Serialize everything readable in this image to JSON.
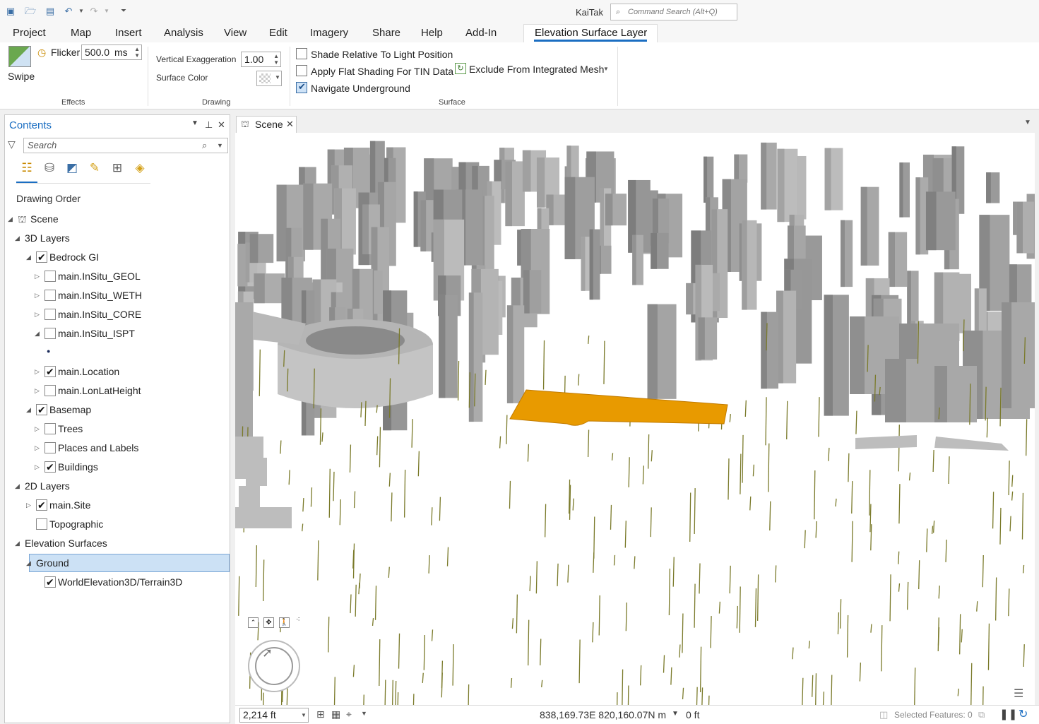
{
  "app": {
    "title": "KaiTak",
    "command_search_placeholder": "Command Search (Alt+Q)"
  },
  "ribbon_tabs": [
    "Project",
    "Map",
    "Insert",
    "Analysis",
    "View",
    "Edit",
    "Imagery",
    "Share",
    "Help",
    "Add-In",
    "Elevation Surface Layer"
  ],
  "ribbon": {
    "effects": {
      "swipe_label": "Swipe",
      "flicker_label": "Flicker",
      "flicker_value": "500.0",
      "flicker_unit": "ms",
      "group_label": "Effects"
    },
    "drawing": {
      "vertical_exaggeration_label": "Vertical Exaggeration",
      "vertical_exaggeration_value": "1.00",
      "surface_color_label": "Surface Color",
      "group_label": "Drawing"
    },
    "surface": {
      "shade_label": "Shade Relative To Light Position",
      "shade_checked": false,
      "flat_label": "Apply Flat Shading For TIN Data",
      "flat_checked": false,
      "navigate_label": "Navigate Underground",
      "navigate_checked": true,
      "exclude_label": "Exclude From Integrated Mesh",
      "group_label": "Surface"
    }
  },
  "contents": {
    "title": "Contents",
    "search_placeholder": "Search",
    "drawing_order_label": "Drawing Order",
    "tree": [
      {
        "label": "Scene",
        "level": 0,
        "expander": "open",
        "checkbox": null,
        "icon": "scene-icon"
      },
      {
        "label": "3D Layers",
        "level": 1,
        "expander": "open",
        "checkbox": null
      },
      {
        "label": "Bedrock GI",
        "level": 2,
        "expander": "open",
        "checkbox": true
      },
      {
        "label": "main.InSitu_GEOL",
        "level": 3,
        "expander": "closed",
        "checkbox": false
      },
      {
        "label": "main.InSitu_WETH",
        "level": 3,
        "expander": "closed",
        "checkbox": false
      },
      {
        "label": "main.InSitu_CORE",
        "level": 3,
        "expander": "closed",
        "checkbox": false
      },
      {
        "label": "main.InSitu_ISPT",
        "level": 3,
        "expander": "open",
        "checkbox": false
      },
      {
        "label": "",
        "level": 3,
        "expander": null,
        "checkbox": null,
        "symbol": "point-symbol"
      },
      {
        "label": "main.Location",
        "level": 3,
        "expander": "closed",
        "checkbox": true
      },
      {
        "label": "main.LonLatHeight",
        "level": 3,
        "expander": "closed",
        "checkbox": false
      },
      {
        "label": "Basemap",
        "level": 2,
        "expander": "open",
        "checkbox": true
      },
      {
        "label": "Trees",
        "level": 3,
        "expander": "closed",
        "checkbox": false
      },
      {
        "label": "Places and Labels",
        "level": 3,
        "expander": "closed",
        "checkbox": false
      },
      {
        "label": "Buildings",
        "level": 3,
        "expander": "closed",
        "checkbox": true
      },
      {
        "label": "2D Layers",
        "level": 1,
        "expander": "open",
        "checkbox": null
      },
      {
        "label": "main.Site",
        "level": 2,
        "expander": "closed",
        "checkbox": true
      },
      {
        "label": "Topographic",
        "level": 2,
        "expander": null,
        "checkbox": false
      },
      {
        "label": "Elevation Surfaces",
        "level": 1,
        "expander": "open",
        "checkbox": null
      },
      {
        "label": "Ground",
        "level": 2,
        "expander": "open",
        "checkbox": null,
        "selected": true
      },
      {
        "label": "WorldElevation3D/Terrain3D",
        "level": 3,
        "expander": null,
        "checkbox": true
      }
    ]
  },
  "scene": {
    "tab_label": "Scene",
    "scale": "2,214 ft",
    "coordinates": "838,169.73E 820,160.07N m",
    "elevation": "0 ft",
    "selected_features": "Selected Features: 0",
    "colors": {
      "building": "#a8a8a8",
      "site": "#e89a00",
      "boreholes": "#7a7a2a"
    }
  }
}
